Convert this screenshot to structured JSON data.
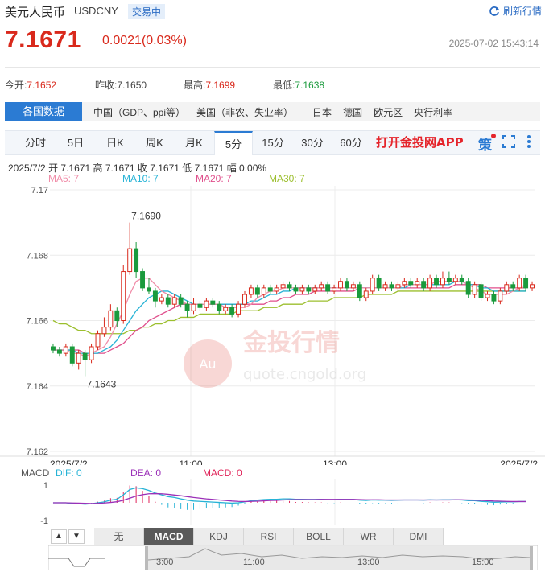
{
  "header": {
    "title": "美元人民币",
    "symbol": "USDCNY",
    "status_badge": "交易中",
    "refresh_label": "刷新行情",
    "price": "7.1671",
    "change": "0.0021(0.03%)",
    "datetime": "2025-07-02 15:43:14"
  },
  "stats": {
    "open_label": "今开:",
    "open_value": "7.1652",
    "prev_close_label": "昨收:",
    "prev_close_value": "7.1650",
    "high_label": "最高:",
    "high_value": "7.1699",
    "low_label": "最低:",
    "low_value": "7.1638"
  },
  "nav": {
    "first": "各国数据",
    "items": [
      "中国（GDP、ppi等）",
      "美国（非农、失业率）",
      "日本",
      "德国",
      "欧元区",
      "央行利率"
    ]
  },
  "tabs": [
    "分时",
    "5日",
    "日K",
    "周K",
    "月K",
    "5分",
    "15分",
    "30分",
    "60分"
  ],
  "active_tab": "5分",
  "app_link": "打开金投网APP",
  "strategy_icon_text": "策",
  "ohlc": {
    "date": "2025/7/2",
    "open_label": "开",
    "open": "7.1671",
    "high_label": "高",
    "high": "7.1671",
    "close_label": "收",
    "close": "7.1671",
    "low_label": "低",
    "low": "7.1671",
    "amp_label": "幅",
    "amp": "0.00%"
  },
  "ma": [
    {
      "label": "MA5: 7",
      "color": "#f08ca8"
    },
    {
      "label": "MA10: 7",
      "color": "#27b3d6"
    },
    {
      "label": "MA20: 7",
      "color": "#e04f8c"
    },
    {
      "label": "MA30: 7",
      "color": "#9cbf2e"
    }
  ],
  "watermark": {
    "brand": "金投行情",
    "url": "quote.cngold.org",
    "logo": "Au"
  },
  "macd": {
    "name": "MACD",
    "dif_label": "DIF: 0",
    "dif_color": "#27b3d6",
    "dea_label": "DEA: 0",
    "dea_color": "#9b30b8",
    "macd_label": "MACD: 0",
    "macd_color": "#e0245a"
  },
  "indicators": [
    "无",
    "MACD",
    "KDJ",
    "RSI",
    "BOLL",
    "WR",
    "DMI"
  ],
  "active_indicator": "MACD",
  "colors": {
    "up": "#d9291c",
    "down": "#1a9a3c",
    "accent": "#2b7bd3"
  },
  "chart_data": {
    "type": "candlestick",
    "title": "",
    "ylim": [
      7.162,
      7.17
    ],
    "y_ticks": [
      "7.17",
      "7.168",
      "7.166",
      "7.164",
      "7.162"
    ],
    "x_tick_labels": [
      "2025/7/2",
      "11:00",
      "13:00",
      "2025/7/2"
    ],
    "annotations": [
      {
        "label": "7.1690",
        "type": "high"
      },
      {
        "label": "7.1643",
        "type": "low"
      }
    ],
    "candles": [
      [
        7.1652,
        7.1651,
        7.1653,
        7.165
      ],
      [
        7.1651,
        7.165,
        7.1652,
        7.1649
      ],
      [
        7.165,
        7.1652,
        7.1653,
        7.1649
      ],
      [
        7.1652,
        7.1647,
        7.1653,
        7.1646
      ],
      [
        7.1647,
        7.165,
        7.1651,
        7.1645
      ],
      [
        7.165,
        7.1648,
        7.1651,
        7.1643
      ],
      [
        7.1648,
        7.1652,
        7.1653,
        7.1647
      ],
      [
        7.1652,
        7.1656,
        7.1657,
        7.1651
      ],
      [
        7.1656,
        7.1658,
        7.1661,
        7.1655
      ],
      [
        7.1658,
        7.1663,
        7.1665,
        7.1657
      ],
      [
        7.1663,
        7.166,
        7.1664,
        7.1658
      ],
      [
        7.166,
        7.1675,
        7.1677,
        7.1659
      ],
      [
        7.1675,
        7.1682,
        7.169,
        7.1674
      ],
      [
        7.1682,
        7.1675,
        7.1684,
        7.1673
      ],
      [
        7.1675,
        7.167,
        7.1676,
        7.1669
      ],
      [
        7.167,
        7.1669,
        7.1673,
        7.1668
      ],
      [
        7.1669,
        7.1666,
        7.167,
        7.1664
      ],
      [
        7.1666,
        7.1667,
        7.1668,
        7.1665
      ],
      [
        7.1667,
        7.1665,
        7.1668,
        7.1664
      ],
      [
        7.1665,
        7.1667,
        7.1668,
        7.1664
      ],
      [
        7.1667,
        7.1665,
        7.1668,
        7.1664
      ],
      [
        7.1665,
        7.1663,
        7.1666,
        7.1661
      ],
      [
        7.1663,
        7.1665,
        7.1667,
        7.1662
      ],
      [
        7.1665,
        7.1664,
        7.1666,
        7.1663
      ],
      [
        7.1664,
        7.1666,
        7.1667,
        7.1663
      ],
      [
        7.1666,
        7.1665,
        7.1667,
        7.1664
      ],
      [
        7.1665,
        7.1663,
        7.1666,
        7.1662
      ],
      [
        7.1663,
        7.1664,
        7.1665,
        7.1662
      ],
      [
        7.1664,
        7.1662,
        7.1665,
        7.1661
      ],
      [
        7.1662,
        7.1665,
        7.1666,
        7.1661
      ],
      [
        7.1665,
        7.1668,
        7.1669,
        7.1664
      ],
      [
        7.1668,
        7.167,
        7.1671,
        7.1667
      ],
      [
        7.167,
        7.1668,
        7.1671,
        7.1667
      ],
      [
        7.1668,
        7.167,
        7.1671,
        7.1667
      ],
      [
        7.167,
        7.1669,
        7.1671,
        7.1668
      ],
      [
        7.1669,
        7.167,
        7.1671,
        7.1668
      ],
      [
        7.167,
        7.1671,
        7.1672,
        7.1669
      ],
      [
        7.1671,
        7.167,
        7.1672,
        7.1669
      ],
      [
        7.167,
        7.1669,
        7.1671,
        7.1668
      ],
      [
        7.1669,
        7.167,
        7.1671,
        7.1668
      ],
      [
        7.167,
        7.1669,
        7.1671,
        7.1668
      ],
      [
        7.1669,
        7.167,
        7.1671,
        7.1668
      ],
      [
        7.167,
        7.1671,
        7.1672,
        7.1669
      ],
      [
        7.1671,
        7.1669,
        7.1672,
        7.1668
      ],
      [
        7.1669,
        7.167,
        7.1671,
        7.1668
      ],
      [
        7.167,
        7.1672,
        7.1673,
        7.1669
      ],
      [
        7.1672,
        7.167,
        7.1673,
        7.1669
      ],
      [
        7.167,
        7.1671,
        7.1672,
        7.1669
      ],
      [
        7.1671,
        7.1667,
        7.1672,
        7.1666
      ],
      [
        7.1667,
        7.1669,
        7.167,
        7.1666
      ],
      [
        7.1669,
        7.1673,
        7.1674,
        7.1668
      ],
      [
        7.1673,
        7.167,
        7.1674,
        7.1669
      ],
      [
        7.167,
        7.1671,
        7.1672,
        7.1669
      ],
      [
        7.1671,
        7.167,
        7.1672,
        7.1669
      ],
      [
        7.167,
        7.1671,
        7.1672,
        7.1669
      ],
      [
        7.1671,
        7.1672,
        7.1673,
        7.167
      ],
      [
        7.1672,
        7.1671,
        7.1673,
        7.167
      ],
      [
        7.1671,
        7.1672,
        7.1673,
        7.167
      ],
      [
        7.1672,
        7.167,
        7.1673,
        7.1669
      ],
      [
        7.167,
        7.1673,
        7.1674,
        7.1669
      ],
      [
        7.1673,
        7.1671,
        7.1674,
        7.167
      ],
      [
        7.1671,
        7.1673,
        7.1675,
        7.167
      ],
      [
        7.1673,
        7.1672,
        7.1675,
        7.1671
      ],
      [
        7.1672,
        7.1673,
        7.1674,
        7.1671
      ],
      [
        7.1673,
        7.1672,
        7.1674,
        7.1671
      ],
      [
        7.1672,
        7.1668,
        7.1673,
        7.1667
      ],
      [
        7.1668,
        7.1671,
        7.1672,
        7.1667
      ],
      [
        7.1671,
        7.1667,
        7.1672,
        7.1666
      ],
      [
        7.1667,
        7.1668,
        7.1669,
        7.1666
      ],
      [
        7.1668,
        7.1666,
        7.1669,
        7.1665
      ],
      [
        7.1666,
        7.1669,
        7.167,
        7.1665
      ],
      [
        7.1669,
        7.1671,
        7.1672,
        7.1668
      ],
      [
        7.1671,
        7.167,
        7.1672,
        7.1669
      ],
      [
        7.167,
        7.1673,
        7.1674,
        7.1669
      ],
      [
        7.1673,
        7.167,
        7.1674,
        7.1669
      ],
      [
        7.167,
        7.1671,
        7.1672,
        7.1669
      ]
    ],
    "ma5": [
      7.1651,
      7.1651,
      7.1651,
      7.165,
      7.165,
      7.1649,
      7.165,
      7.1651,
      7.1652,
      7.1655,
      7.1659,
      7.1663,
      7.1668,
      7.1672,
      7.1673,
      7.1673,
      7.1671,
      7.1669,
      7.1668,
      7.1667,
      7.1666,
      7.1665,
      7.1665,
      7.1665,
      7.1665,
      7.1665,
      7.1665,
      7.1664,
      7.1664,
      7.1664,
      7.1664,
      7.1665,
      7.1667,
      7.1668,
      7.1669,
      7.1669,
      7.167,
      7.167,
      7.167,
      7.167,
      7.167,
      7.167,
      7.167,
      7.167,
      7.167,
      7.167,
      7.167,
      7.167,
      7.167,
      7.167,
      7.167,
      7.167,
      7.167,
      7.167,
      7.167,
      7.1671,
      7.1671,
      7.1671,
      7.1671,
      7.1671,
      7.1672,
      7.1672,
      7.1672,
      7.1672,
      7.1672,
      7.1671,
      7.167,
      7.1669,
      7.1668,
      7.1668,
      7.1668,
      7.1668,
      7.1669,
      7.167,
      7.1671
    ],
    "ma10": [
      7.1651,
      7.1651,
      7.1651,
      7.1651,
      7.165,
      7.165,
      7.165,
      7.165,
      7.1651,
      7.1652,
      7.1654,
      7.1657,
      7.166,
      7.1663,
      7.1665,
      7.1667,
      7.1668,
      7.1669,
      7.1669,
      7.1668,
      7.1667,
      7.1666,
      7.1665,
      7.1665,
      7.1665,
      7.1665,
      7.1665,
      7.1665,
      7.1665,
      7.1665,
      7.1665,
      7.1666,
      7.1666,
      7.1667,
      7.1668,
      7.1668,
      7.1669,
      7.1669,
      7.167,
      7.167,
      7.167,
      7.167,
      7.167,
      7.167,
      7.167,
      7.167,
      7.167,
      7.167,
      7.167,
      7.167,
      7.167,
      7.167,
      7.167,
      7.167,
      7.167,
      7.167,
      7.1671,
      7.1671,
      7.1671,
      7.1671,
      7.1671,
      7.1671,
      7.1671,
      7.1672,
      7.1672,
      7.1671,
      7.1671,
      7.167,
      7.167,
      7.1669,
      7.1669,
      7.1669,
      7.1669,
      7.1669,
      7.1669
    ],
    "ma20": [
      7.1651,
      7.1651,
      7.1651,
      7.1651,
      7.1651,
      7.165,
      7.165,
      7.165,
      7.165,
      7.1651,
      7.1652,
      7.1653,
      7.1655,
      7.1657,
      7.1658,
      7.166,
      7.1661,
      7.1662,
      7.1663,
      7.1664,
      7.1665,
      7.1665,
      7.1665,
      7.1665,
      7.1665,
      7.1665,
      7.1665,
      7.1665,
      7.1665,
      7.1665,
      7.1665,
      7.1665,
      7.1665,
      7.1665,
      7.1666,
      7.1666,
      7.1667,
      7.1667,
      7.1668,
      7.1668,
      7.1668,
      7.1669,
      7.1669,
      7.1669,
      7.1669,
      7.1669,
      7.1669,
      7.1669,
      7.167,
      7.167,
      7.167,
      7.167,
      7.167,
      7.167,
      7.167,
      7.167,
      7.167,
      7.167,
      7.167,
      7.167,
      7.167,
      7.167,
      7.167,
      7.1671,
      7.1671,
      7.1671,
      7.1671,
      7.1671,
      7.167,
      7.167,
      7.167,
      7.167,
      7.167,
      7.167,
      7.167
    ],
    "ma30": [
      7.166,
      7.1659,
      7.1659,
      7.1658,
      7.1657,
      7.1657,
      7.1656,
      7.1656,
      7.1656,
      7.1656,
      7.1656,
      7.1656,
      7.1657,
      7.1657,
      7.1658,
      7.1658,
      7.1659,
      7.1659,
      7.166,
      7.166,
      7.1661,
      7.1661,
      7.1661,
      7.1662,
      7.1662,
      7.1662,
      7.1662,
      7.1662,
      7.1662,
      7.1663,
      7.1663,
      7.1663,
      7.1663,
      7.1664,
      7.1664,
      7.1664,
      7.1665,
      7.1665,
      7.1665,
      7.1665,
      7.1666,
      7.1666,
      7.1666,
      7.1666,
      7.1667,
      7.1667,
      7.1667,
      7.1667,
      7.1667,
      7.1668,
      7.1668,
      7.1668,
      7.1668,
      7.1668,
      7.1669,
      7.1669,
      7.1669,
      7.1669,
      7.1669,
      7.1669,
      7.1669,
      7.1669,
      7.1669,
      7.1669,
      7.1669,
      7.1669,
      7.1669,
      7.1669,
      7.1669,
      7.1669,
      7.1669,
      7.1669,
      7.1669,
      7.1669,
      7.1669
    ],
    "macd_dif": [
      0,
      0,
      0,
      -0.05,
      -0.05,
      -0.08,
      -0.05,
      0,
      0.05,
      0.15,
      0.2,
      0.45,
      0.75,
      0.85,
      0.8,
      0.7,
      0.55,
      0.45,
      0.35,
      0.3,
      0.22,
      0.15,
      0.1,
      0.08,
      0.06,
      0.04,
      0.02,
      0,
      -0.02,
      0,
      0.05,
      0.12,
      0.15,
      0.18,
      0.2,
      0.2,
      0.22,
      0.22,
      0.2,
      0.2,
      0.19,
      0.19,
      0.2,
      0.18,
      0.18,
      0.2,
      0.19,
      0.19,
      0.15,
      0.13,
      0.16,
      0.15,
      0.15,
      0.14,
      0.15,
      0.16,
      0.16,
      0.16,
      0.15,
      0.17,
      0.16,
      0.17,
      0.17,
      0.17,
      0.16,
      0.12,
      0.12,
      0.08,
      0.06,
      0.03,
      0.04,
      0.05,
      0.05,
      0.07,
      0.07
    ],
    "macd_dea": [
      0,
      0,
      0,
      -0.01,
      -0.02,
      -0.03,
      -0.04,
      -0.03,
      -0.01,
      0.02,
      0.06,
      0.14,
      0.26,
      0.38,
      0.46,
      0.51,
      0.52,
      0.51,
      0.48,
      0.44,
      0.4,
      0.35,
      0.3,
      0.26,
      0.22,
      0.19,
      0.16,
      0.13,
      0.1,
      0.08,
      0.07,
      0.08,
      0.09,
      0.11,
      0.13,
      0.14,
      0.16,
      0.17,
      0.18,
      0.18,
      0.18,
      0.18,
      0.19,
      0.19,
      0.19,
      0.19,
      0.19,
      0.19,
      0.18,
      0.17,
      0.17,
      0.17,
      0.16,
      0.16,
      0.16,
      0.16,
      0.16,
      0.16,
      0.16,
      0.16,
      0.16,
      0.16,
      0.16,
      0.17,
      0.17,
      0.16,
      0.15,
      0.14,
      0.12,
      0.1,
      0.09,
      0.08,
      0.07,
      0.07,
      0.07
    ]
  }
}
